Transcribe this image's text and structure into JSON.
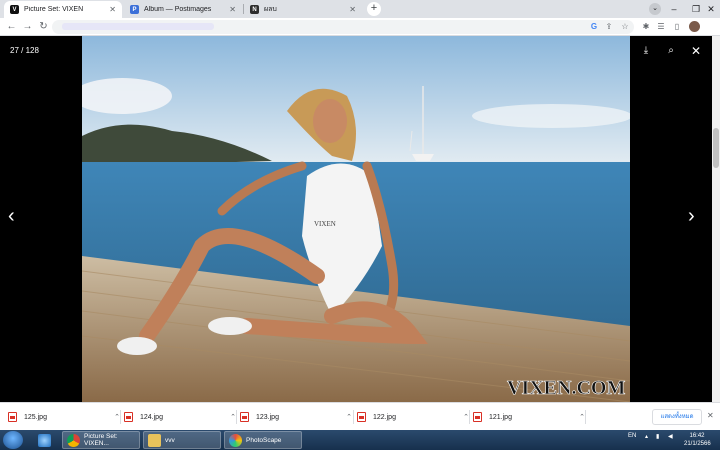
{
  "tabs": [
    {
      "title": "Picture Set: VIXEN",
      "favicon": "V",
      "active": true
    },
    {
      "title": "Album — Postimages",
      "favicon": "P",
      "active": false
    },
    {
      "title": "ผลบ",
      "favicon": "N",
      "active": false
    }
  ],
  "toolbar": {
    "icons": [
      "back-icon",
      "forward-icon",
      "reload-icon",
      "google-icon",
      "share-icon",
      "star-icon",
      "extensions-icon",
      "reading-list-icon",
      "side-panel-icon",
      "profile-avatar"
    ]
  },
  "viewer": {
    "counter": "27 / 128",
    "watermark": "VIXEN.COM",
    "swimsuit_logo": "VIXEN",
    "tools": [
      "download-icon",
      "zoom-icon",
      "close-icon"
    ]
  },
  "downloads": [
    {
      "name": "125.jpg"
    },
    {
      "name": "124.jpg"
    },
    {
      "name": "123.jpg"
    },
    {
      "name": "122.jpg"
    },
    {
      "name": "121.jpg"
    }
  ],
  "shelf": {
    "show_all": "แสดงทั้งหมด"
  },
  "taskbar": {
    "apps": [
      {
        "label": "",
        "icon": "ie-icon"
      },
      {
        "label": "Picture Set: VIXEN...",
        "icon": "chrome-icon"
      },
      {
        "label": "vvv",
        "icon": "folder-icon"
      },
      {
        "label": "PhotoScape",
        "icon": "photoscape-icon"
      }
    ],
    "lang": "EN",
    "time": "16:42",
    "date": "21/1/2566"
  },
  "colors": {
    "accent": "#1a73e8",
    "tab_bar": "#dee1e6",
    "viewer_bg": "#000000",
    "sea": "#2f6f9a",
    "sky": "#cfe0ee"
  }
}
